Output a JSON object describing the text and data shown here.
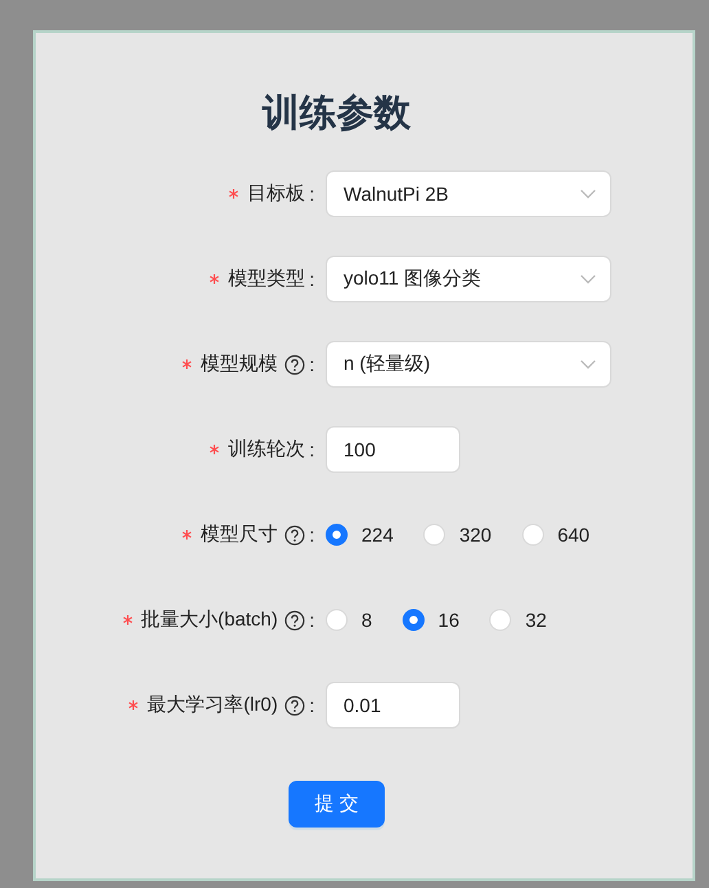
{
  "title": "训练参数",
  "fields": [
    {
      "kind": "select",
      "required": true,
      "label": "目标板",
      "help": false,
      "colon": ":",
      "value": "WalnutPi 2B"
    },
    {
      "kind": "select",
      "required": true,
      "label": "模型类型",
      "help": false,
      "colon": ":",
      "value": "yolo11 图像分类"
    },
    {
      "kind": "select",
      "required": true,
      "label": "模型规模",
      "help": true,
      "colon": ":",
      "value": "n (轻量级)"
    },
    {
      "kind": "input",
      "required": true,
      "label": "训练轮次",
      "help": false,
      "colon": ":",
      "value": "100"
    },
    {
      "kind": "radio",
      "required": true,
      "label": "模型尺寸",
      "help": true,
      "colon": ":",
      "options": [
        {
          "label": "224",
          "selected": true
        },
        {
          "label": "320",
          "selected": false
        },
        {
          "label": "640",
          "selected": false
        }
      ]
    },
    {
      "kind": "radio",
      "required": true,
      "label": "批量大小(batch)",
      "help": true,
      "colon": ":",
      "options": [
        {
          "label": "8",
          "selected": false
        },
        {
          "label": "16",
          "selected": true
        },
        {
          "label": "32",
          "selected": false
        }
      ]
    },
    {
      "kind": "input",
      "required": true,
      "label": "最大学习率(lr0)",
      "help": true,
      "colon": ":",
      "value": "0.01"
    }
  ],
  "submit": "提 交"
}
